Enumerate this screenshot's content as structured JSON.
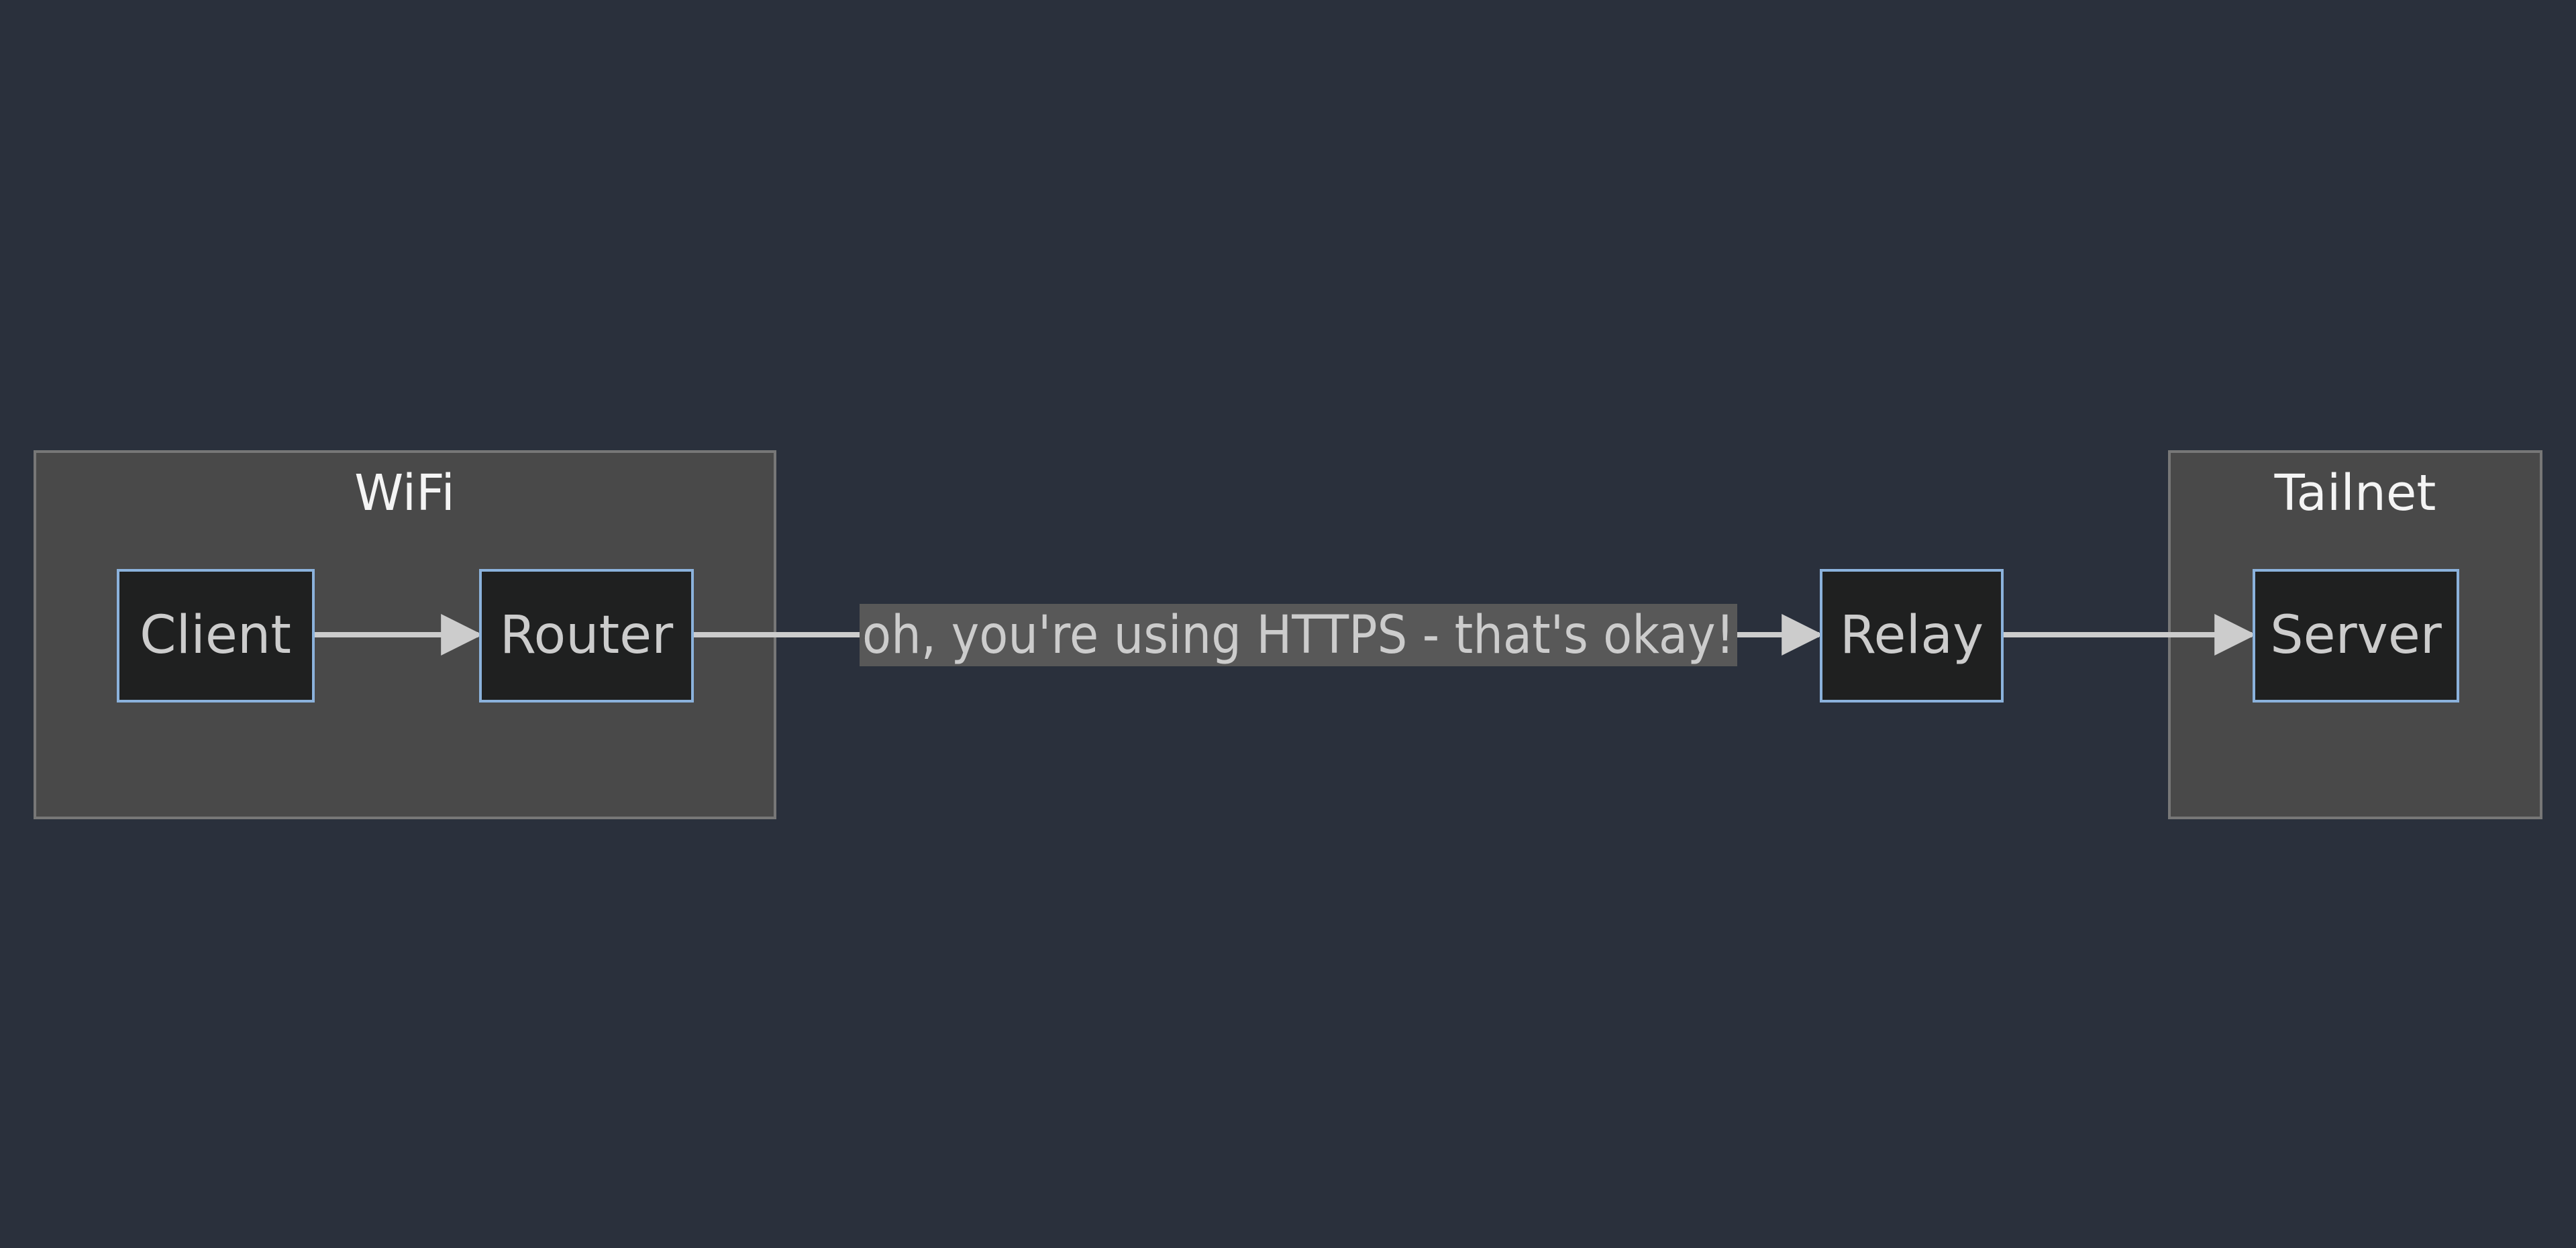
{
  "colors": {
    "background": "#2a303c",
    "cluster_fill": "#494949",
    "cluster_stroke": "#777777",
    "cluster_title": "#f4f4f4",
    "node_fill": "#1f2020",
    "node_stroke": "#8bb2dc",
    "node_text": "#cccccc",
    "edge": "#cccccc",
    "edge_label_bg": "#585858",
    "edge_label_text": "#cccccc"
  },
  "diagram": {
    "clusters": [
      {
        "id": "wifi",
        "title": "WiFi"
      },
      {
        "id": "tailnet",
        "title": "Tailnet"
      }
    ],
    "nodes": [
      {
        "id": "client",
        "label": "Client",
        "cluster": "wifi"
      },
      {
        "id": "router",
        "label": "Router",
        "cluster": "wifi"
      },
      {
        "id": "relay",
        "label": "Relay",
        "cluster": ""
      },
      {
        "id": "server",
        "label": "Server",
        "cluster": "tailnet"
      }
    ],
    "edges": [
      {
        "from": "client",
        "to": "router",
        "label": ""
      },
      {
        "from": "router",
        "to": "relay",
        "label": "oh, you're using HTTPS - that's okay!"
      },
      {
        "from": "relay",
        "to": "server",
        "label": ""
      }
    ]
  }
}
